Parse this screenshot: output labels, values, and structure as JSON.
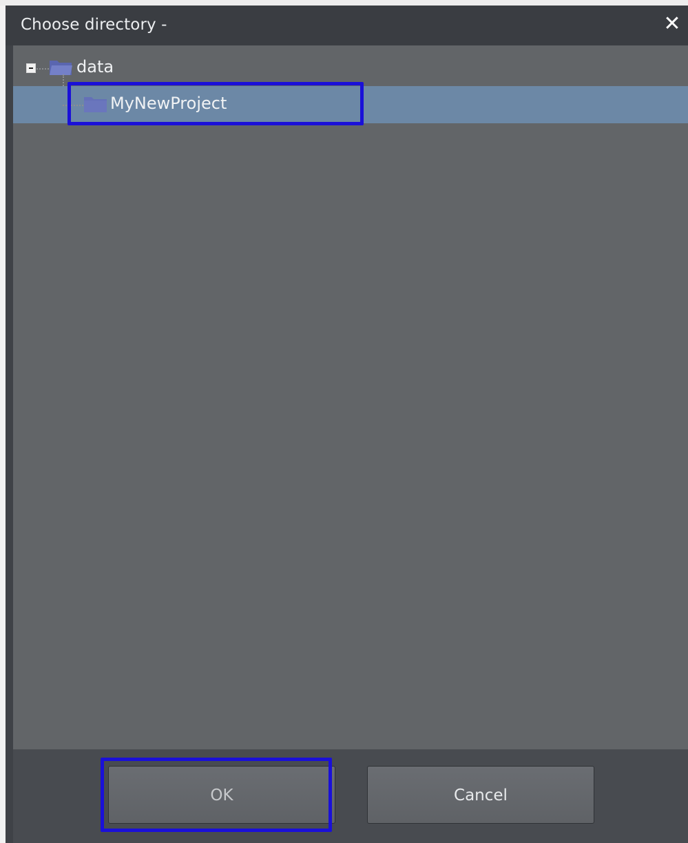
{
  "dialog": {
    "title": "Choose directory   -",
    "close_icon": "close-icon"
  },
  "tree": {
    "root": {
      "label": "data",
      "expanded": true,
      "toggle_icon": "collapse-minus-icon",
      "icon": "folder-open-icon"
    },
    "children": [
      {
        "label": "MyNewProject",
        "selected": true,
        "icon": "folder-icon"
      }
    ]
  },
  "buttons": {
    "ok_label": "OK",
    "cancel_label": "Cancel"
  },
  "colors": {
    "selection": "#6c88a6",
    "highlight_annotation": "#1a10d8",
    "panel": "#626568",
    "titlebar": "#3a3d42"
  }
}
